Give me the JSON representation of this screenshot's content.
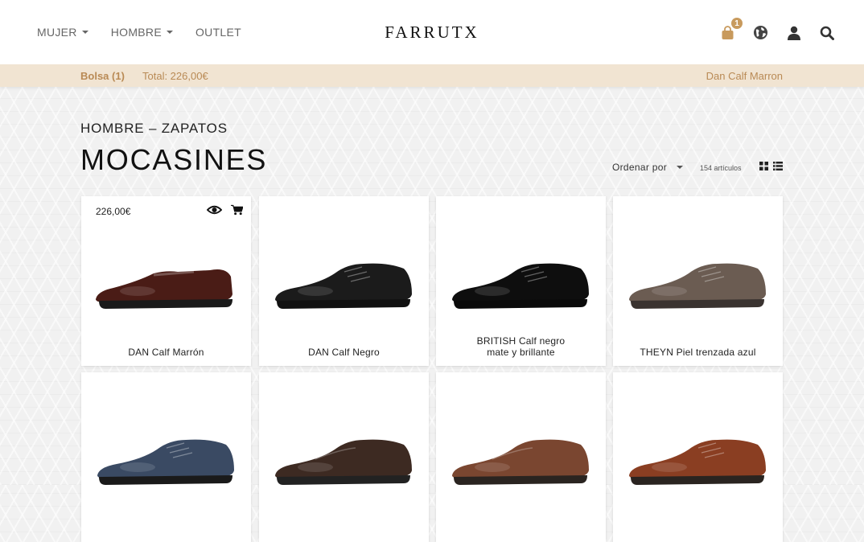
{
  "nav": {
    "menu": [
      "MUJER",
      "HOMBRE",
      "OUTLET"
    ],
    "logo": "FARRUTX",
    "cart_count": "1"
  },
  "bag": {
    "label": "Bolsa (1)",
    "total": "Total: 226,00€",
    "item": "Dan Calf Marron"
  },
  "page": {
    "breadcrumb": "HOMBRE – ZAPATOS",
    "title": "MOCASINES",
    "sort_label": "Ordenar por",
    "count": "154 artículos"
  },
  "products": [
    {
      "name": "DAN Calf Marrón",
      "price": "226,00€",
      "color": "#4a1c16",
      "sole": "#1a1a1a",
      "style": "loafer",
      "hovered": true
    },
    {
      "name": "DAN Calf Negro",
      "price": "",
      "color": "#1b1b1b",
      "sole": "#111111",
      "style": "oxford",
      "hovered": false
    },
    {
      "name": "BRITISH Calf negro mate y brillante",
      "price": "",
      "color": "#0e0e0e",
      "sole": "#0a0a0a",
      "style": "oxford",
      "hovered": false
    },
    {
      "name": "THEYN Piel trenzada azul",
      "price": "",
      "color": "#6b5c52",
      "sole": "#3a3330",
      "style": "derby",
      "hovered": false
    },
    {
      "name": "",
      "price": "",
      "color": "#3a4a63",
      "sole": "#1a1a1a",
      "style": "derby",
      "hovered": false
    },
    {
      "name": "",
      "price": "",
      "color": "#3d2a22",
      "sole": "#222222",
      "style": "moc",
      "hovered": false
    },
    {
      "name": "",
      "price": "",
      "color": "#7a4630",
      "sole": "#2a2420",
      "style": "moc",
      "hovered": false
    },
    {
      "name": "",
      "price": "",
      "color": "#8a3e22",
      "sole": "#2a2420",
      "style": "brogue",
      "hovered": false
    }
  ],
  "colors": {
    "accent": "#b98a55",
    "bag_bar": "#f1e4d2",
    "badge": "#c89a5d"
  }
}
